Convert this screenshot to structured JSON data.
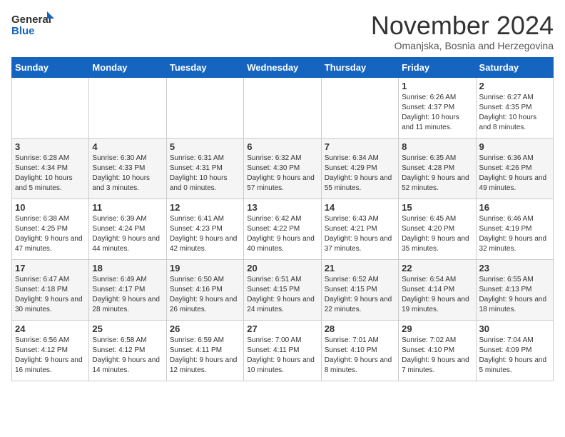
{
  "logo": {
    "general": "General",
    "blue": "Blue"
  },
  "title": "November 2024",
  "subtitle": "Omanjska, Bosnia and Herzegovina",
  "weekdays": [
    "Sunday",
    "Monday",
    "Tuesday",
    "Wednesday",
    "Thursday",
    "Friday",
    "Saturday"
  ],
  "weeks": [
    [
      {
        "day": "",
        "info": ""
      },
      {
        "day": "",
        "info": ""
      },
      {
        "day": "",
        "info": ""
      },
      {
        "day": "",
        "info": ""
      },
      {
        "day": "",
        "info": ""
      },
      {
        "day": "1",
        "info": "Sunrise: 6:26 AM\nSunset: 4:37 PM\nDaylight: 10 hours and 11 minutes."
      },
      {
        "day": "2",
        "info": "Sunrise: 6:27 AM\nSunset: 4:35 PM\nDaylight: 10 hours and 8 minutes."
      }
    ],
    [
      {
        "day": "3",
        "info": "Sunrise: 6:28 AM\nSunset: 4:34 PM\nDaylight: 10 hours and 5 minutes."
      },
      {
        "day": "4",
        "info": "Sunrise: 6:30 AM\nSunset: 4:33 PM\nDaylight: 10 hours and 3 minutes."
      },
      {
        "day": "5",
        "info": "Sunrise: 6:31 AM\nSunset: 4:31 PM\nDaylight: 10 hours and 0 minutes."
      },
      {
        "day": "6",
        "info": "Sunrise: 6:32 AM\nSunset: 4:30 PM\nDaylight: 9 hours and 57 minutes."
      },
      {
        "day": "7",
        "info": "Sunrise: 6:34 AM\nSunset: 4:29 PM\nDaylight: 9 hours and 55 minutes."
      },
      {
        "day": "8",
        "info": "Sunrise: 6:35 AM\nSunset: 4:28 PM\nDaylight: 9 hours and 52 minutes."
      },
      {
        "day": "9",
        "info": "Sunrise: 6:36 AM\nSunset: 4:26 PM\nDaylight: 9 hours and 49 minutes."
      }
    ],
    [
      {
        "day": "10",
        "info": "Sunrise: 6:38 AM\nSunset: 4:25 PM\nDaylight: 9 hours and 47 minutes."
      },
      {
        "day": "11",
        "info": "Sunrise: 6:39 AM\nSunset: 4:24 PM\nDaylight: 9 hours and 44 minutes."
      },
      {
        "day": "12",
        "info": "Sunrise: 6:41 AM\nSunset: 4:23 PM\nDaylight: 9 hours and 42 minutes."
      },
      {
        "day": "13",
        "info": "Sunrise: 6:42 AM\nSunset: 4:22 PM\nDaylight: 9 hours and 40 minutes."
      },
      {
        "day": "14",
        "info": "Sunrise: 6:43 AM\nSunset: 4:21 PM\nDaylight: 9 hours and 37 minutes."
      },
      {
        "day": "15",
        "info": "Sunrise: 6:45 AM\nSunset: 4:20 PM\nDaylight: 9 hours and 35 minutes."
      },
      {
        "day": "16",
        "info": "Sunrise: 6:46 AM\nSunset: 4:19 PM\nDaylight: 9 hours and 32 minutes."
      }
    ],
    [
      {
        "day": "17",
        "info": "Sunrise: 6:47 AM\nSunset: 4:18 PM\nDaylight: 9 hours and 30 minutes."
      },
      {
        "day": "18",
        "info": "Sunrise: 6:49 AM\nSunset: 4:17 PM\nDaylight: 9 hours and 28 minutes."
      },
      {
        "day": "19",
        "info": "Sunrise: 6:50 AM\nSunset: 4:16 PM\nDaylight: 9 hours and 26 minutes."
      },
      {
        "day": "20",
        "info": "Sunrise: 6:51 AM\nSunset: 4:15 PM\nDaylight: 9 hours and 24 minutes."
      },
      {
        "day": "21",
        "info": "Sunrise: 6:52 AM\nSunset: 4:15 PM\nDaylight: 9 hours and 22 minutes."
      },
      {
        "day": "22",
        "info": "Sunrise: 6:54 AM\nSunset: 4:14 PM\nDaylight: 9 hours and 19 minutes."
      },
      {
        "day": "23",
        "info": "Sunrise: 6:55 AM\nSunset: 4:13 PM\nDaylight: 9 hours and 18 minutes."
      }
    ],
    [
      {
        "day": "24",
        "info": "Sunrise: 6:56 AM\nSunset: 4:12 PM\nDaylight: 9 hours and 16 minutes."
      },
      {
        "day": "25",
        "info": "Sunrise: 6:58 AM\nSunset: 4:12 PM\nDaylight: 9 hours and 14 minutes."
      },
      {
        "day": "26",
        "info": "Sunrise: 6:59 AM\nSunset: 4:11 PM\nDaylight: 9 hours and 12 minutes."
      },
      {
        "day": "27",
        "info": "Sunrise: 7:00 AM\nSunset: 4:11 PM\nDaylight: 9 hours and 10 minutes."
      },
      {
        "day": "28",
        "info": "Sunrise: 7:01 AM\nSunset: 4:10 PM\nDaylight: 9 hours and 8 minutes."
      },
      {
        "day": "29",
        "info": "Sunrise: 7:02 AM\nSunset: 4:10 PM\nDaylight: 9 hours and 7 minutes."
      },
      {
        "day": "30",
        "info": "Sunrise: 7:04 AM\nSunset: 4:09 PM\nDaylight: 9 hours and 5 minutes."
      }
    ]
  ]
}
